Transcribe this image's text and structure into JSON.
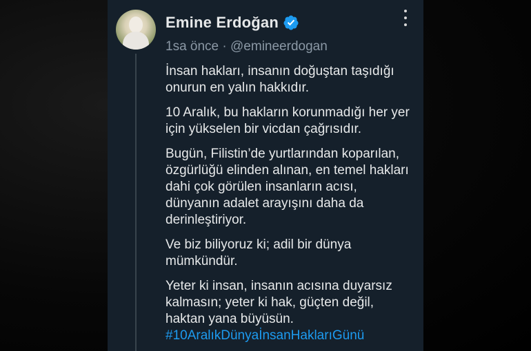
{
  "post": {
    "author_name": "Emine Erdoğan",
    "time": "1sa önce",
    "separator": "·",
    "handle": "@emineerdogan",
    "paragraphs": [
      "İnsan hakları, insanın doğuştan taşıdığı onurun en yalın hakkıdır.",
      "10 Aralık, bu hakların korunmadığı her yer için yükselen bir vicdan çağrısıdır.",
      "Bugün, Filistin’de yurtlarından koparılan, özgürlüğü elinden alınan, en temel hakları dahi çok görülen insanların acısı, dünyanın adalet arayışını daha da derinleştiriyor.",
      "Ve biz biliyoruz ki; adil bir dünya mümkündür.",
      "Yeter ki insan, insanın acısına duyarsız kalmasın; yeter ki hak, güçten değil, haktan yana büyüsün."
    ],
    "hashtag": "#10AralıkDünyaİnsanHaklarıGünü"
  },
  "colors": {
    "card_background": "#15202b",
    "text": "#e7e9ea",
    "muted": "#8b98a5",
    "link": "#1d9bf0",
    "verified": "#1d9bf0"
  },
  "icons": {
    "verified": "verified-badge-icon",
    "more": "more-vertical-icon"
  }
}
